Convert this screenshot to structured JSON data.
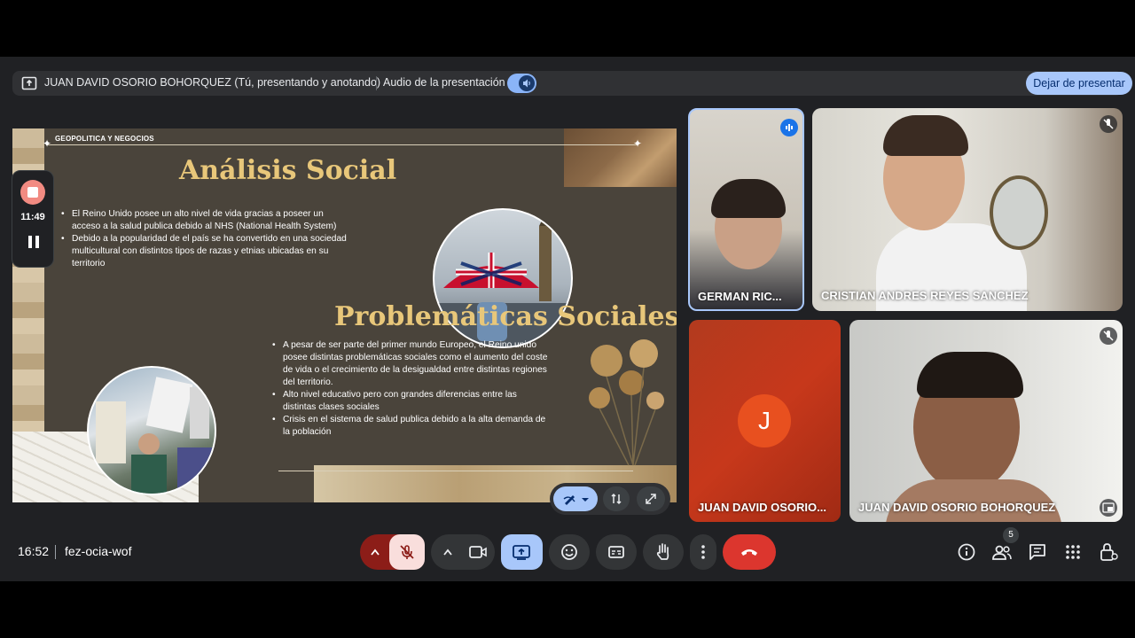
{
  "presenting_bar": {
    "presenter_text": "JUAN DAVID OSORIO BOHORQUEZ (Tú, presentando y anotando)",
    "audio_label": "Audio de la presentación",
    "stop_button": "Dejar de presentar"
  },
  "slide": {
    "tag": "GEOPOLITICA Y NEGOCIOS",
    "title1": "Análisis Social",
    "bullets1": [
      "El Reino Unido posee un alto nivel de vida gracias a poseer un acceso a la salud publica debido al NHS (National Health System)",
      "Debido a la popularidad de el país se ha convertido en una sociedad multicultural con distintos tipos de razas y etnias ubicadas en su territorio"
    ],
    "title2": "Problemáticas Sociales",
    "bullets2": [
      "A pesar de ser parte del primer mundo Europeo, el Reino unido posee distintas problemáticas sociales como el aumento del coste de vida o el crecimiento de la desigualdad entre distintas regiones del territorio.",
      "Alto nivel educativo pero con grandes diferencias entre las distintas clases sociales",
      "Crisis en el sistema de salud publica debido a la alta demanda de la población"
    ]
  },
  "recording": {
    "time": "11:49"
  },
  "participants": [
    {
      "name": "GERMAN RIC..."
    },
    {
      "name": "CRISTIAN ANDRES REYES SANCHEZ"
    },
    {
      "name": "JUAN DAVID OSORIO...",
      "initial": "J"
    },
    {
      "name": "JUAN DAVID OSORIO BOHORQUEZ"
    }
  ],
  "bottom_bar": {
    "time": "16:52",
    "meeting_code": "fez-ocia-wof",
    "people_count": "5"
  },
  "colors": {
    "meet_background": "#202124",
    "accent": "#a8c7fa",
    "hangup": "#dc362e",
    "title_gold": "#e8c77a"
  }
}
